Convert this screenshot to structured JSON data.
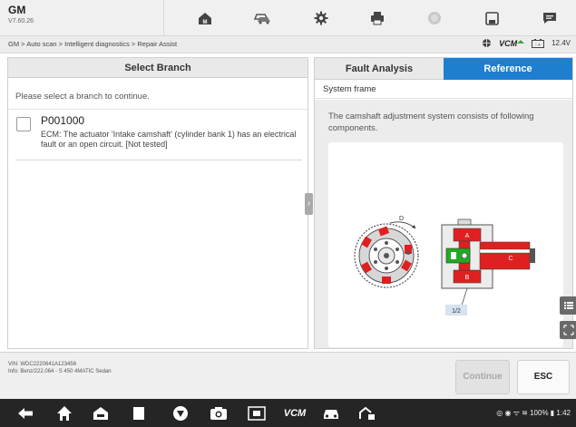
{
  "header": {
    "brand": "GM",
    "version": "V7.60.26",
    "toolbar_icons": [
      "home-icon",
      "vehicle-swap-icon",
      "settings-icon",
      "print-icon",
      "help-icon",
      "save-icon",
      "chat-icon"
    ]
  },
  "breadcrumb": {
    "text": "GM > Auto scan > Intelligent diagnostics > Repair Assist"
  },
  "status": {
    "vcm_label": "VCM",
    "voltage": "12.4V"
  },
  "left_panel": {
    "title": "Select Branch",
    "prompt": "Please select a branch to continue.",
    "branches": [
      {
        "code": "P001000",
        "description": "ECM: The actuator 'Intake camshaft' (cylinder bank 1) has an electrical fault or an open circuit. [Not tested]"
      }
    ]
  },
  "right_panel": {
    "tabs": [
      {
        "label": "Fault Analysis",
        "active": false
      },
      {
        "label": "Reference",
        "active": true
      }
    ],
    "subtitle": "System frame",
    "description": "The camshaft adjustment system consists of following components.",
    "figure_labels": {
      "d": "D",
      "a": "A",
      "b": "B",
      "c": "C",
      "page": "1/2"
    }
  },
  "footer": {
    "vin": "VIN: WDC2220641A123456",
    "info": "Info: Benz/222.064 - S 450 4MATIC Sedan",
    "continue_label": "Continue",
    "esc_label": "ESC"
  },
  "navbar": {
    "vcm_label": "VCM",
    "system_status": "100%",
    "time": "1:42"
  },
  "colors": {
    "accent_blue": "#1e7fd0",
    "diagram_red": "#e02020",
    "diagram_green": "#22aa22"
  }
}
